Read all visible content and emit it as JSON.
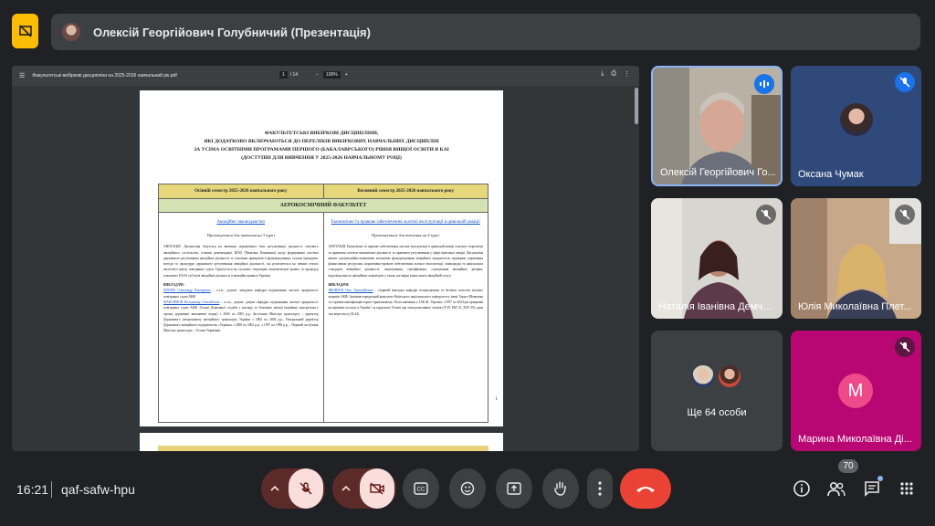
{
  "header": {
    "presenter_title": "Олексій Георгійович Голубничий (Презентація)"
  },
  "pdf": {
    "filename": "Факультетські вибіркові дисципліни на 2025-2026 навчальний рік.pdf",
    "page_current": "1",
    "page_total": "/ 14",
    "zoom": "100%",
    "doc_title_lines": [
      "ФАКУЛЬТЕТСЬКІ ВИБІРКОВІ ДИСЦИПЛІНИ,",
      "ЯКІ ДОДАТКОВО ВКЛЮЧАЮТЬСЯ ДО ПЕРЕЛІКІВ ВИБІРКОВИХ НАВЧАЛЬНИХ ДИСЦИПЛІН",
      "ЗА УСІМА ОСВІТНІМИ ПРОГРАМАМИ ПЕРШОГО (БАКАЛАВРСЬКОГО) РІВНЯ ВИЩОЇ ОСВІТИ В КАІ",
      "(ДОСТУПНІ ДЛЯ ВИВЧЕННЯ У 2025-2026 НАВЧАЛЬНОМУ РОЦІ)"
    ],
    "col1_header": "Осінній семестр 2025-2026 навчального року",
    "col2_header": "Весняний семестр 2025-2026 навчального року",
    "faculty": "АЕРОКОСМІЧНИЙ ФАКУЛЬТЕТ",
    "col1_course": "Авіаційне законодавство",
    "col2_course": "Економічне та правове забезпечення льотної експлуатації в цивільній авіації",
    "col1_taught": "Пропонується для вивчення на 3 курсі",
    "col2_taught": "Пропонується для вивчення на 4 курсі",
    "col1_annotation": "АНОТАЦІЯ. Дисципліна базується на вивченні нормативної бази регулювання діяльності світового авіаційного суспільства; основні рекомендації ІКАО (Чиказька Конвенція) щодо формування системи державного регулювання авіаційної діяльності та основних принципів її функціонування; сучасні принципи, методи та процедури державного регулювання авіаційної діяльності, які реалізуються на певних етапах життєвого циклу повітряних суден. Грунтується на сучасних тенденціях імплементації правил та процедур ухвалених EASA суб'єктів авіаційної діяльності в авіаційні правила України.",
    "col2_annotation": "АНОТАЦІЯ. Економічне та правове забезпечення льотної експлуатації в цивільній авіації охоплює теоретичні та практичні аспекти економічної діяльності та правового регулювання у сфері цивільної авіації. Дисципліна вивчає організаційно-економічні механізми функціонування авіаційних підприємств, принципи управління фінансовими ресурсами, нормативно-правове забезпечення льотної експлуатації, міжнародні та національні стандарти авіаційної діяльності, ліцензування, сертифікацію, страхування авіаційних ризиків, відповідальність авіаційних операторів, а також договірні відносини в авіаційній галузі.",
    "lecturers_label": "ВИКЛАДАЧІ:",
    "col1_lect1_name": "ПОПОВ Олександр Вікторович",
    "col1_lect1_text": " – к.т.н., доцент, завідувач кафедри підтримання льотної придатності повітряних суден АКФ.",
    "col1_lect2_name": "МАКСИМОВ Володимир Олексійович",
    "col1_lect2_text": " – к.т.н., доцент, доцент кафедри підтримання льотної придатності повітряних суден АКФ. Голова Державної служби з нагляду за безпекою авіації (керівник центрального органу державної виконавчої влади) з 2004 по 2005 р.р. Заступник Міністра транспорту – директор Державного департаменту авіаційного транспорту України з 2002 по 2004 р.р., Генеральний директор Державного авіаційного підприємства «Україна» з 2000 по 2002 р.р., з 1997 по 1998 р.р. – Перший заступник Міністра транспорту – Голова Укравіації.",
    "col2_lect_name": "ЯКОВЛЄВ Олег Анатолійович",
    "col2_lect_text": " – старший викладач кафедри попередження та безпеки польотів льотних апаратів АКФ. Закінчив юридичний факультет Київського національного університету імені Тараса Шевченка та отримав кваліфікацію юрист-правознавець. Після навчання у ЗАК Ж. України, з 1997 по 2024 рік працював на керівних посадах в Україні і за кордоном. Освоїв три типи реактивних літаків (Л-39, МіГ-21, МіГ-29), один тип вертольоту (К-44).",
    "page_number": "1"
  },
  "participants": [
    {
      "name": "Олексій Георгійович Го...",
      "state": "speaking"
    },
    {
      "name": "Оксана Чумак",
      "state": "muted"
    },
    {
      "name": "Наталія Іванівна Демче...",
      "state": "muted"
    },
    {
      "name": "Юлія Миколаївна Плет...",
      "state": "muted"
    },
    {
      "name": "Ще 64 особи",
      "state": "group"
    },
    {
      "name": "Марина Миколаївна Ді...",
      "state": "muted",
      "initial": "M"
    }
  ],
  "bottom": {
    "time": "16:21",
    "meeting_code": "qaf-safw-hpu",
    "people_count": "70"
  },
  "icons": {
    "app": "present-off-icon",
    "mic": "mic-off-icon",
    "cam": "videocam-off-icon",
    "cc": "closed-captions-icon",
    "emoji": "emoji-icon",
    "present": "present-to-all-icon",
    "hand": "raise-hand-icon",
    "more": "more-vert-icon",
    "end": "call-end-icon",
    "info": "info-icon",
    "people": "people-icon",
    "chat": "chat-icon",
    "activities": "apps-grid-icon"
  },
  "colors": {
    "end_call": "#ea4335",
    "muted_control_bg": "#f9dedc",
    "speaking_badge": "#1a73e8",
    "marina_tile": "#b80672",
    "avatar_m": "#ee4a8a"
  }
}
